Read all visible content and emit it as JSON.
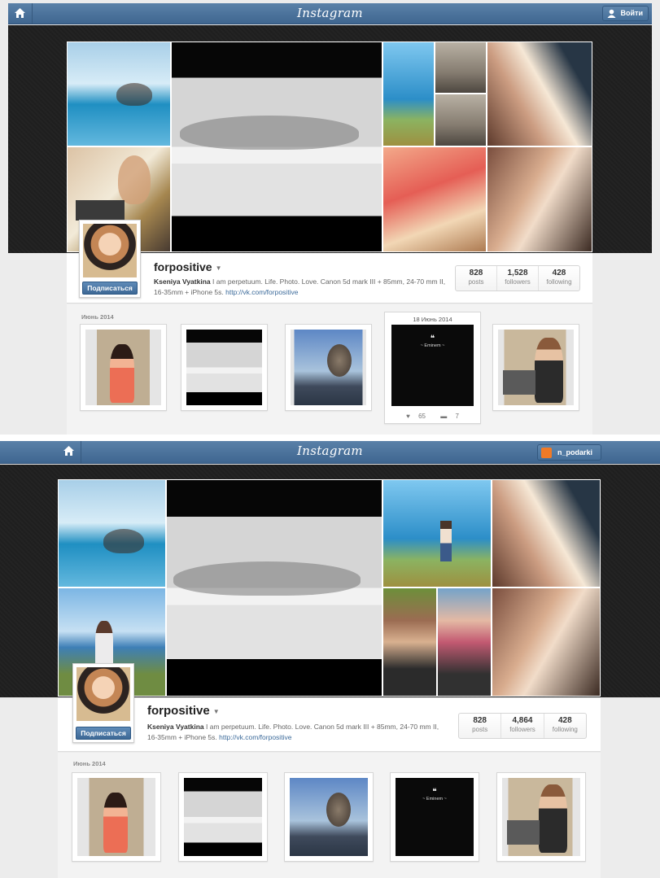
{
  "top": {
    "logo": "Instagram",
    "login_label": "Войти",
    "profile": {
      "username": "forpositive",
      "follow_label": "Подписаться",
      "full_name": "Kseniya Vyatkina",
      "bio": "I am perpetuum. Life. Photo. Love. Canon 5d mark III + 85mm, 24-70 mm II, 16-35mm + iPhone 5s.",
      "link": "http://vk.com/forpositive",
      "stats": [
        {
          "num": "828",
          "label": "posts"
        },
        {
          "num": "1,528",
          "label": "followers"
        },
        {
          "num": "428",
          "label": "following"
        }
      ]
    },
    "month": "Июнь 2014",
    "highlight": {
      "date": "18 Июнь 2014",
      "likes": "65",
      "comments": "7"
    },
    "quote": {
      "author": "~ Eminem ~"
    }
  },
  "bottom": {
    "logo": "Instagram",
    "user_label": "n_podarki",
    "profile": {
      "username": "forpositive",
      "follow_label": "Подписаться",
      "full_name": "Kseniya Vyatkina",
      "bio": "I am perpetuum. Life. Photo. Love. Canon 5d mark III + 85mm, 24-70 mm II, 16-35mm + iPhone 5s.",
      "link": "http://vk.com/forpositive",
      "stats": [
        {
          "num": "828",
          "label": "posts"
        },
        {
          "num": "4,864",
          "label": "followers"
        },
        {
          "num": "428",
          "label": "following"
        }
      ]
    },
    "month": "Июнь 2014",
    "quote": {
      "author": "~ Eminem ~"
    }
  },
  "icons": {
    "home": "home-icon",
    "user": "user-icon",
    "heart": "heart-icon",
    "comment": "comment-icon",
    "quote": "quote-mark-icon"
  },
  "colors": {
    "header": "#4a7199",
    "button": "#3d6895",
    "link": "#3b6a9a"
  }
}
